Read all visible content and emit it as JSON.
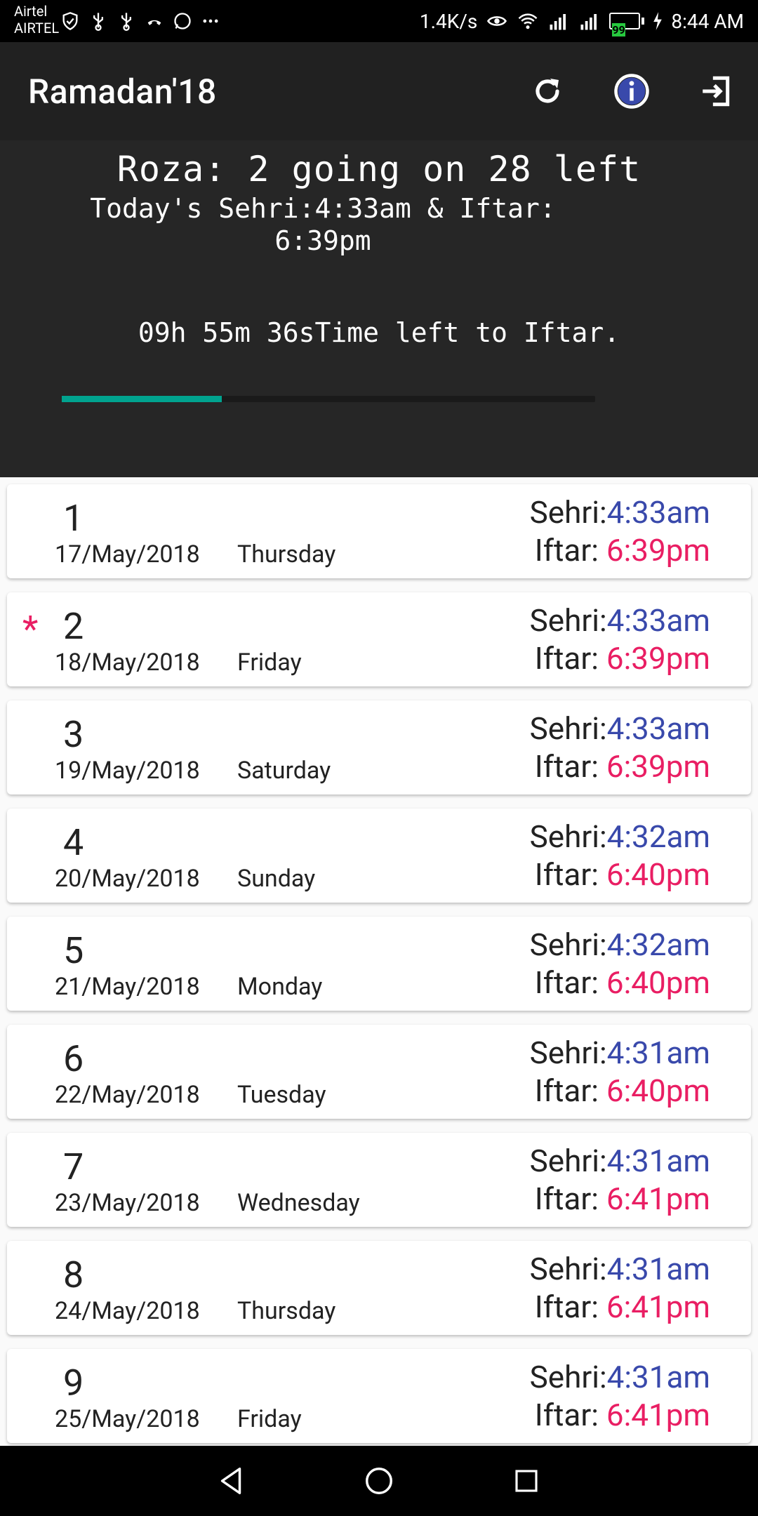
{
  "status_bar": {
    "carrier_top": "Airtel",
    "carrier_bottom": "AIRTEL",
    "speed": "1.4K/s",
    "battery": "99",
    "time": "8:44 AM"
  },
  "app_bar": {
    "title": "Ramadan'18",
    "actions": [
      "refresh-icon",
      "info-icon",
      "exit-icon"
    ]
  },
  "header": {
    "roza_status": "Roza: 2 going on 28 left",
    "today_times": "Today's Sehri:4:33am & Iftar: 6:39pm",
    "countdown": "09h 55m 36sTime left to Iftar.",
    "progress_fraction": 0.3
  },
  "colors": {
    "sehri_time": "#3949ab",
    "iftar_time": "#e91e63",
    "progress": "#00a38f",
    "current_marker": "#e91e63"
  },
  "days": [
    {
      "num": "1",
      "date": "17/May/2018",
      "day": "Thursday",
      "sehri_label": "Sehri:",
      "sehri": "4:33am",
      "iftar_label": "Iftar:",
      "iftar": "6:39pm",
      "current": false
    },
    {
      "num": "2",
      "date": "18/May/2018",
      "day": "Friday",
      "sehri_label": "Sehri:",
      "sehri": "4:33am",
      "iftar_label": "Iftar:",
      "iftar": "6:39pm",
      "current": true,
      "marker": "*"
    },
    {
      "num": "3",
      "date": "19/May/2018",
      "day": "Saturday",
      "sehri_label": "Sehri:",
      "sehri": "4:33am",
      "iftar_label": "Iftar:",
      "iftar": "6:39pm",
      "current": false
    },
    {
      "num": "4",
      "date": "20/May/2018",
      "day": "Sunday",
      "sehri_label": "Sehri:",
      "sehri": "4:32am",
      "iftar_label": "Iftar:",
      "iftar": "6:40pm",
      "current": false
    },
    {
      "num": "5",
      "date": "21/May/2018",
      "day": "Monday",
      "sehri_label": "Sehri:",
      "sehri": "4:32am",
      "iftar_label": "Iftar:",
      "iftar": "6:40pm",
      "current": false
    },
    {
      "num": "6",
      "date": "22/May/2018",
      "day": "Tuesday",
      "sehri_label": "Sehri:",
      "sehri": "4:31am",
      "iftar_label": "Iftar:",
      "iftar": "6:40pm",
      "current": false
    },
    {
      "num": "7",
      "date": "23/May/2018",
      "day": "Wednesday",
      "sehri_label": "Sehri:",
      "sehri": "4:31am",
      "iftar_label": "Iftar:",
      "iftar": "6:41pm",
      "current": false
    },
    {
      "num": "8",
      "date": "24/May/2018",
      "day": "Thursday",
      "sehri_label": "Sehri:",
      "sehri": "4:31am",
      "iftar_label": "Iftar:",
      "iftar": "6:41pm",
      "current": false
    },
    {
      "num": "9",
      "date": "25/May/2018",
      "day": "Friday",
      "sehri_label": "Sehri:",
      "sehri": "4:31am",
      "iftar_label": "Iftar:",
      "iftar": "6:41pm",
      "current": false
    }
  ],
  "nav_bar": [
    "back-icon",
    "home-icon",
    "recents-icon"
  ]
}
